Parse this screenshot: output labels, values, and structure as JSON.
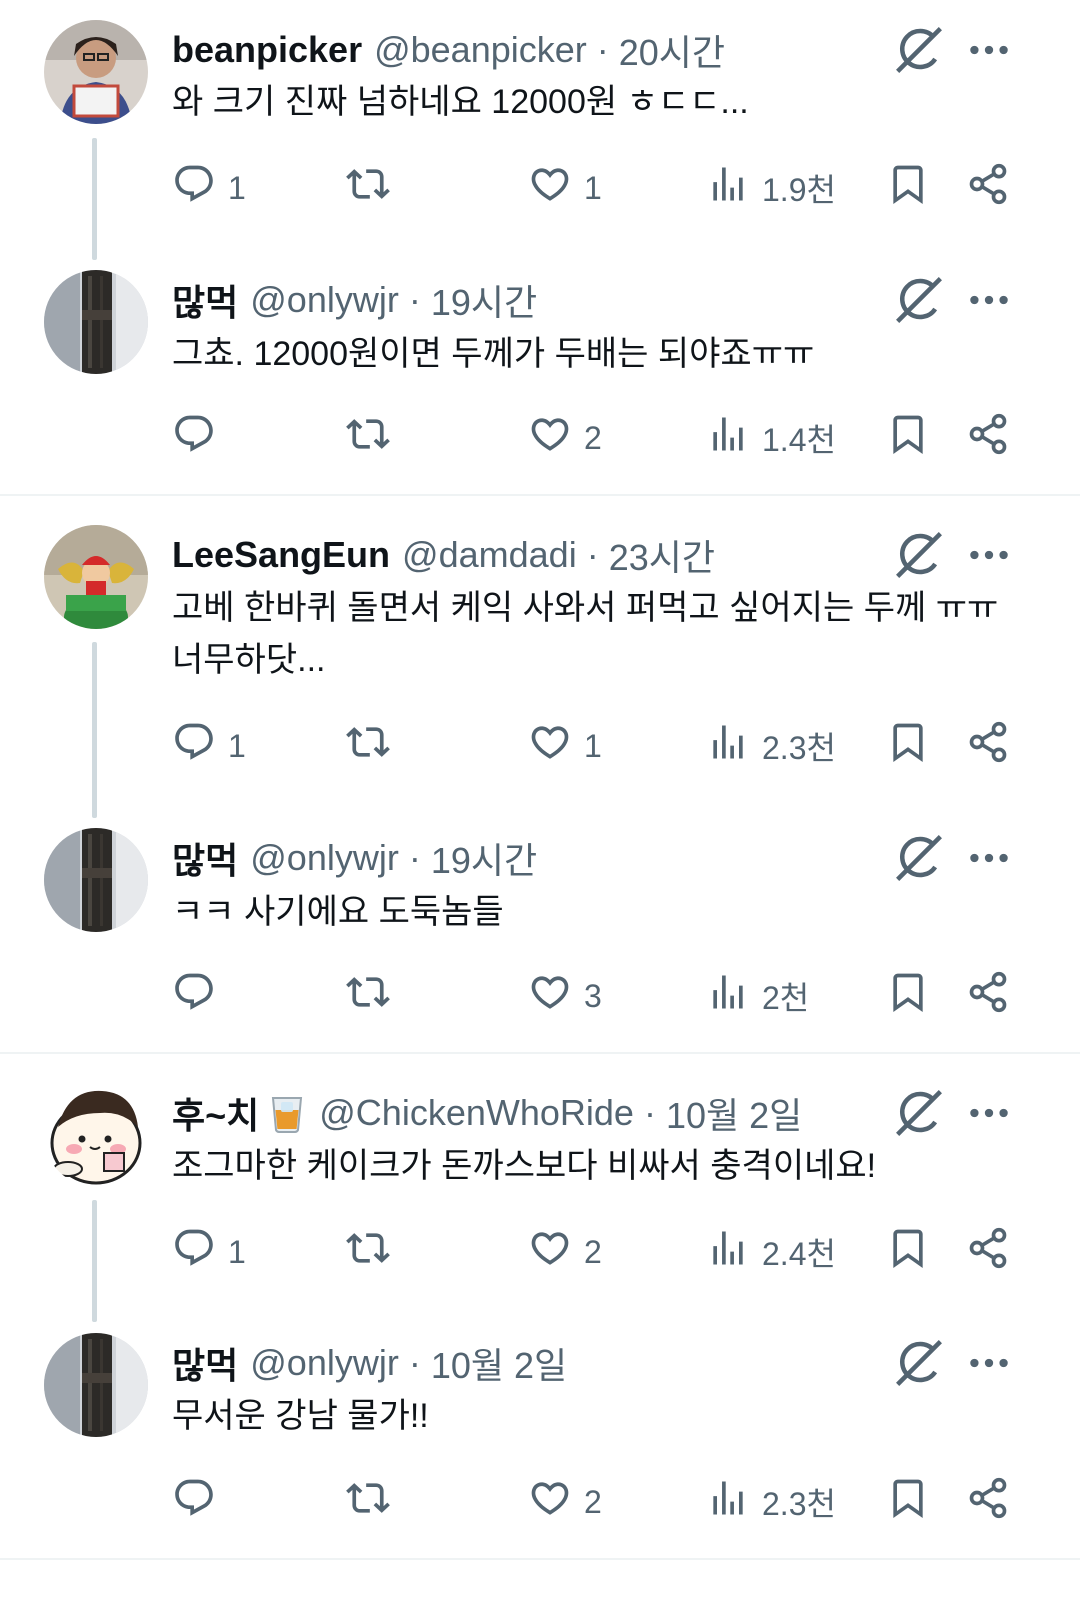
{
  "icons": {
    "reply": "reply-bubble-icon",
    "retweet": "retweet-icon",
    "like": "heart-icon",
    "views": "analytics-bars-icon",
    "bookmark": "bookmark-icon",
    "share": "share-icon",
    "grok": "grok-icon",
    "more": "more-dots-icon"
  },
  "colors": {
    "text": "#0f1419",
    "secondary": "#536471",
    "divider": "#eff3f4",
    "thread_line": "#cfd9de"
  },
  "posts": [
    {
      "name": "beanpicker",
      "handle": "@beanpicker",
      "sep": "·",
      "time": "20시간",
      "text": "와 크기 진짜 넘하네요 12000원 ㅎㄷㄷ...",
      "replies": "1",
      "retweets": "",
      "likes": "1",
      "views": "1.9천"
    },
    {
      "name": "많먹",
      "handle": "@onlywjr",
      "sep": "·",
      "time": "19시간",
      "text": "그쵸. 12000원이면 두께가 두배는 되야죠ㅠㅠ",
      "replies": "",
      "retweets": "",
      "likes": "2",
      "views": "1.4천"
    },
    {
      "name": "LeeSangEun",
      "handle": "@damdadi",
      "sep": "·",
      "time": "23시간",
      "text": "고베 한바퀴 돌면서 케익 사와서 퍼먹고 싶어지는 두께 ㅠㅠ 너무하닷...",
      "replies": "1",
      "retweets": "",
      "likes": "1",
      "views": "2.3천"
    },
    {
      "name": "많먹",
      "handle": "@onlywjr",
      "sep": "·",
      "time": "19시간",
      "text": "ㅋㅋ 사기에요 도둑놈들",
      "replies": "",
      "retweets": "",
      "likes": "3",
      "views": "2천"
    },
    {
      "name": "후~치",
      "handle": "@ChickenWhoRide",
      "sep": "·",
      "time": "10월 2일",
      "text": "조그마한 케이크가 돈까스보다 비싸서 충격이네요!",
      "replies": "1",
      "retweets": "",
      "likes": "2",
      "views": "2.4천",
      "emoji": "whisky-glass-emoji"
    },
    {
      "name": "많먹",
      "handle": "@onlywjr",
      "sep": "·",
      "time": "10월 2일",
      "text": "무서운 강남 물가!!",
      "replies": "",
      "retweets": "",
      "likes": "2",
      "views": "2.3천"
    }
  ]
}
